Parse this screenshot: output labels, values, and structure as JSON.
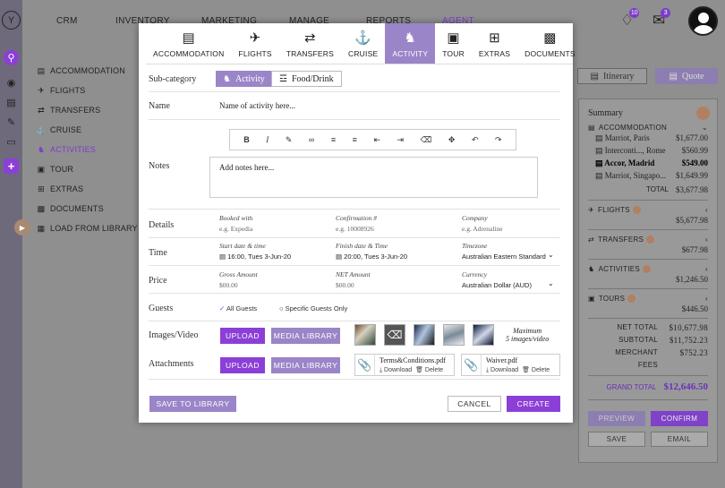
{
  "nav": {
    "items": [
      "CRM",
      "INVENTORY",
      "MARKETING",
      "MANAGE",
      "REPORTS",
      "AGENT"
    ],
    "bell_count": "10",
    "mail_count": "3"
  },
  "leftmenu": [
    "ACCOMMODATION",
    "FLIGHTS",
    "TRANSFERS",
    "CRUISE",
    "ACTIVITIES",
    "TOUR",
    "EXTRAS",
    "DOCUMENTS",
    "LOAD FROM LIBRARY"
  ],
  "buttons": {
    "itinerary": "Itinerary",
    "quote": "Quote"
  },
  "summary": {
    "title": "Summary",
    "accommodation": "ACCOMMODATION",
    "hotels": [
      {
        "name": "Marriot, Paris",
        "price": "$1,677.00"
      },
      {
        "name": "Interconti..., Rome",
        "price": "$560.99"
      },
      {
        "name": "Accor, Madrid",
        "price": "$549.00"
      },
      {
        "name": "Marriot, Singapo...",
        "price": "$1,649.99"
      }
    ],
    "acc_total_label": "TOTAL",
    "acc_total": "$3,677.98",
    "flights": "FLIGHTS",
    "flights_total": "$5,677.98",
    "transfers": "TRANSFERS",
    "transfers_total": "$677.98",
    "activities": "ACTIVITIES",
    "activities_total": "$1,246.50",
    "tours": "TOURS",
    "tours_total": "$446.50",
    "net_label": "NET TOTAL",
    "net": "$10,677.98",
    "subtotal_label": "SUBTOTAL",
    "subtotal": "$11,752.23",
    "fees_label": "MERCHANT FEES",
    "fees": "$752.23",
    "grand_label": "GRAND TOTAL",
    "grand": "$12,646.50",
    "preview": "PREVIEW",
    "confirm": "CONFIRM",
    "save": "SAVE",
    "email": "EMAIL"
  },
  "modal": {
    "tabs": [
      "ACCOMMODATION",
      "FLIGHTS",
      "TRANSFERS",
      "CRUISE",
      "ACTIVITY",
      "TOUR",
      "EXTRAS",
      "DOCUMENTS"
    ],
    "subcategory_label": "Sub-category",
    "sub_activity": "Activity",
    "sub_food": "Food/Drink",
    "name_label": "Name",
    "name_placeholder": "Name of activity here...",
    "notes_label": "Notes",
    "notes_placeholder": "Add notes here...",
    "details_label": "Details",
    "booked_with_label": "Booked with",
    "booked_with": "e.g. Expedia",
    "confirmation_label": "Confirmation #",
    "confirmation": "e.g. 10008926",
    "company_label": "Company",
    "company": "e.g. Adrenaline",
    "time_label": "Time",
    "start_label": "Start date & time",
    "start": "16:00, Tues 3-Jun-20",
    "finish_label": "Finish date & Time",
    "finish": "20:00, Tues 3-Jun-20",
    "timezone_label": "Timezone",
    "timezone": "Australian Eastern Standard",
    "price_label": "Price",
    "gross_label": "Gross Amount",
    "gross": "$00.00",
    "net_label": "NET Amount",
    "net": "$00.00",
    "currency_label": "Currency",
    "currency": "Australian Dollar (AUD)",
    "guests_label": "Guests",
    "all_guests": "All Guests",
    "specific_guests": "Specific Guests Only",
    "images_label": "Images/Video",
    "upload": "UPLOAD",
    "media_library": "MEDIA LIBRARY",
    "max_line1": "Maximum",
    "max_line2": "5 images/video",
    "attachments_label": "Attachments",
    "files": [
      {
        "name": "Terms&Conditions.pdf",
        "download": "Download",
        "delete": "Delete"
      },
      {
        "name": "Waiver.pdf",
        "download": "Download",
        "delete": "Delete"
      }
    ],
    "save_library": "SAVE TO LIBRARY",
    "cancel": "CANCEL",
    "create": "CREATE"
  },
  "colors": {
    "accent": "#8c3fd6",
    "accent_light": "#9a85c8",
    "copper": "#b08060"
  }
}
